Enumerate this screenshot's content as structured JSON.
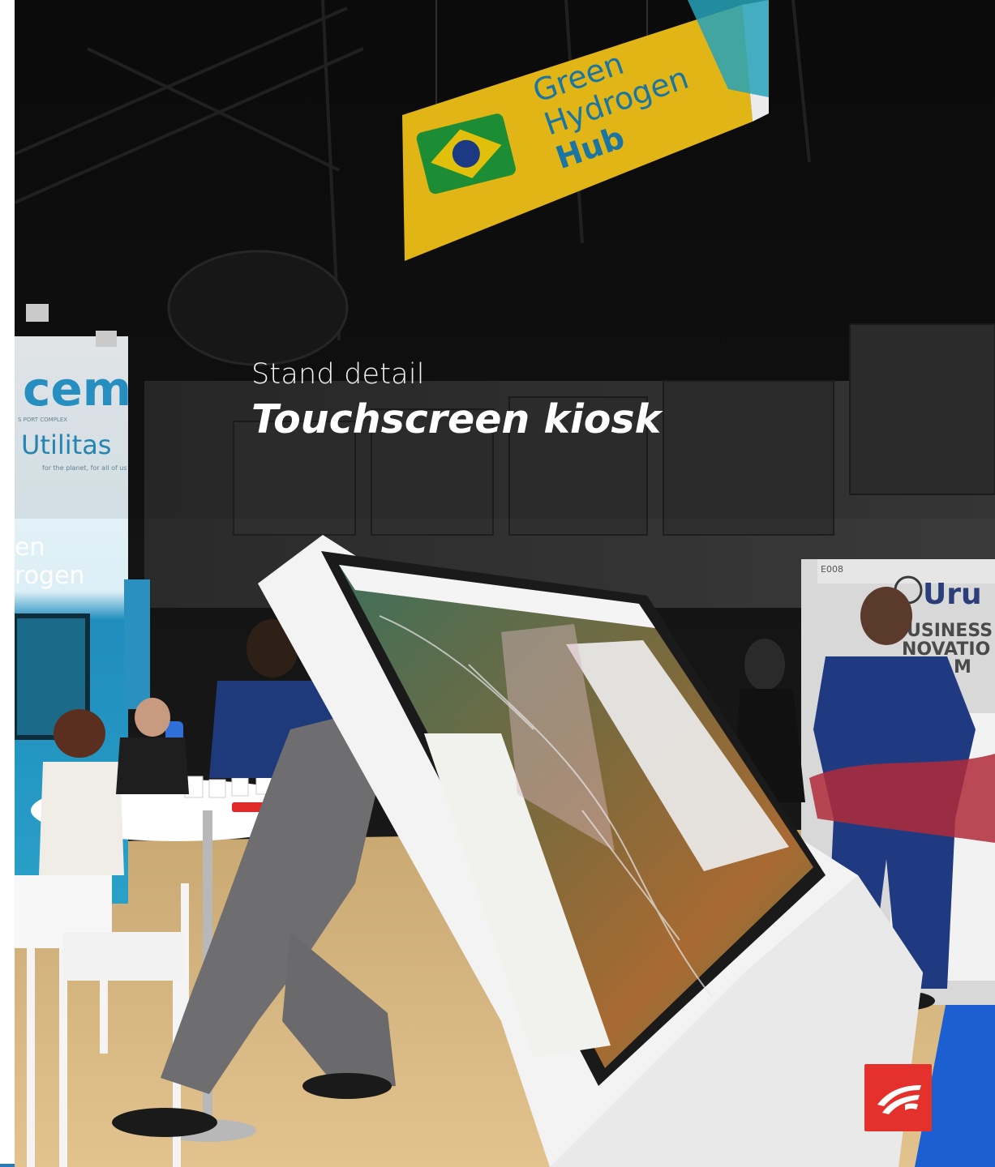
{
  "caption": {
    "subtitle": "Stand detail",
    "title": "Touchscreen kiosk"
  },
  "photo": {
    "alt": "Trade-fair stand with a white touchscreen kiosk showing an aerial map, under a Green Hydrogen Hub sign",
    "hanging_sign": {
      "line1": "Green",
      "line2": "Hydrogen",
      "line3": "Hub"
    },
    "left_booth": {
      "logo_text": "cem",
      "tagline": "S PORT COMPLEX",
      "brand": "Utilitas",
      "brand_tagline": "for the planet, for all of us",
      "panel_text_1": "en",
      "panel_text_2": "rogen"
    },
    "right_booth": {
      "sign": "Uru",
      "panel_1": "USINESS",
      "panel_2": "NOVATIO",
      "panel_3": "M",
      "stand_number": "E008"
    }
  },
  "colors": {
    "accent_red": "#e4312b",
    "sign_yellow": "#f5c518",
    "brazil_green": "#1f9a3a",
    "booth_teal": "#2aa0c8"
  },
  "logo": {
    "icon": "brand-wing-icon"
  }
}
